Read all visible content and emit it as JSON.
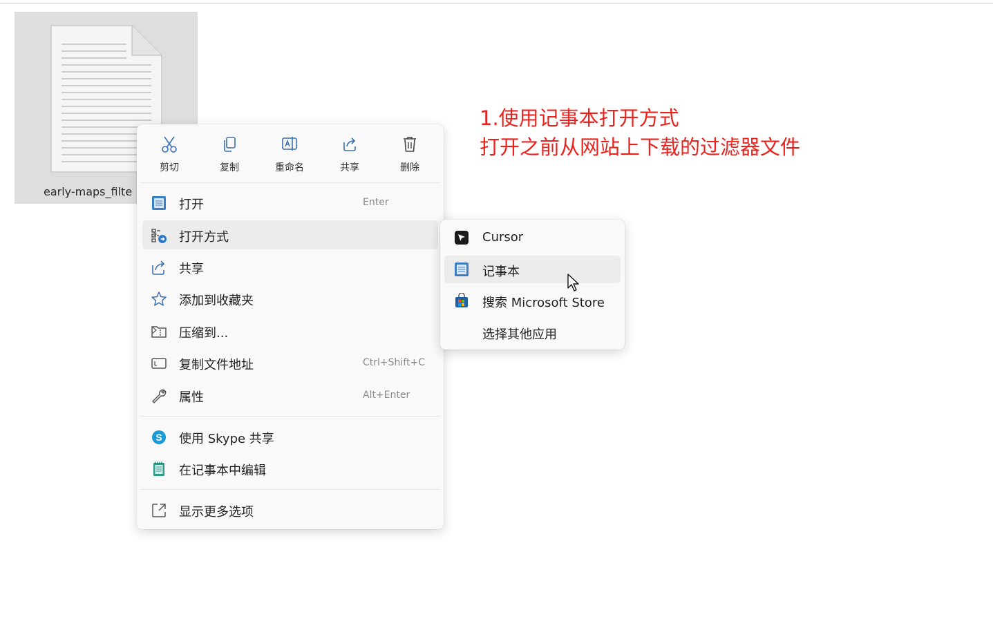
{
  "file": {
    "name": "early-maps_filte"
  },
  "annotation": {
    "line1": "1.使用记事本打开方式",
    "line2": "打开之前从网站上下载的过滤器文件",
    "color": "#e8231e"
  },
  "quick_actions": [
    {
      "label": "剪切",
      "icon": "scissors-icon"
    },
    {
      "label": "复制",
      "icon": "copy-icon"
    },
    {
      "label": "重命名",
      "icon": "rename-icon"
    },
    {
      "label": "共享",
      "icon": "share-icon"
    },
    {
      "label": "删除",
      "icon": "trash-icon"
    }
  ],
  "menu": {
    "open": {
      "label": "打开",
      "shortcut": "Enter",
      "icon": "notepad-icon"
    },
    "open_with": {
      "label": "打开方式",
      "icon": "open-with-icon"
    },
    "share": {
      "label": "共享",
      "icon": "share-icon"
    },
    "favorite": {
      "label": "添加到收藏夹",
      "icon": "star-icon"
    },
    "compress": {
      "label": "压缩到...",
      "icon": "zip-folder-icon"
    },
    "copy_path": {
      "label": "复制文件地址",
      "shortcut": "Ctrl+Shift+C",
      "icon": "copy-path-icon"
    },
    "properties": {
      "label": "属性",
      "shortcut": "Alt+Enter",
      "icon": "wrench-icon"
    },
    "skype": {
      "label": "使用 Skype 共享",
      "icon": "skype-icon"
    },
    "edit_notepad": {
      "label": "在记事本中编辑",
      "icon": "notepad-icon"
    },
    "more": {
      "label": "显示更多选项",
      "icon": "more-options-icon"
    }
  },
  "submenu": {
    "cursor": {
      "label": "Cursor",
      "icon": "cursor-app-icon"
    },
    "notepad": {
      "label": "记事本",
      "icon": "notepad-icon"
    },
    "store": {
      "label": "搜索 Microsoft Store",
      "icon": "store-icon"
    },
    "other": {
      "label": "选择其他应用"
    }
  }
}
